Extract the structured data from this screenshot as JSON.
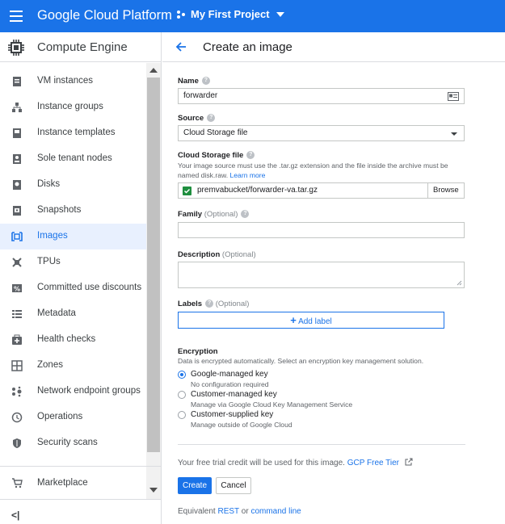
{
  "topbar": {
    "app_title": "Google Cloud Platform",
    "project": "My First Project"
  },
  "sidebar": {
    "title": "Compute Engine",
    "items": [
      {
        "label": "VM instances",
        "icon": "vm-icon"
      },
      {
        "label": "Instance groups",
        "icon": "group-icon"
      },
      {
        "label": "Instance templates",
        "icon": "template-icon"
      },
      {
        "label": "Sole tenant nodes",
        "icon": "node-icon"
      },
      {
        "label": "Disks",
        "icon": "disk-icon"
      },
      {
        "label": "Snapshots",
        "icon": "snapshot-icon"
      },
      {
        "label": "Images",
        "icon": "image-icon",
        "active": true
      },
      {
        "label": "TPUs",
        "icon": "tpu-icon"
      },
      {
        "label": "Committed use discounts",
        "icon": "percent-icon"
      },
      {
        "label": "Metadata",
        "icon": "metadata-icon"
      },
      {
        "label": "Health checks",
        "icon": "health-icon"
      },
      {
        "label": "Zones",
        "icon": "zones-icon"
      },
      {
        "label": "Network endpoint groups",
        "icon": "network-icon"
      },
      {
        "label": "Operations",
        "icon": "clock-icon"
      },
      {
        "label": "Security scans",
        "icon": "shield-icon"
      }
    ],
    "marketplace": "Marketplace",
    "collapse": "<|"
  },
  "page": {
    "title": "Create an image"
  },
  "form": {
    "name_label": "Name",
    "name_value": "forwarder",
    "source_label": "Source",
    "source_value": "Cloud Storage file",
    "csf_label": "Cloud Storage file",
    "csf_help": "Your image source must use the .tar.gz extension and the file inside the archive must be named disk.raw.",
    "learn_more": "Learn more",
    "csf_value": "premvabucket/forwarder-va.tar.gz",
    "browse": "Browse",
    "family_label": "Family",
    "optional": "(Optional)",
    "description_label": "Description",
    "labels_label": "Labels",
    "add_label": "Add label",
    "encryption_label": "Encryption",
    "encryption_help": "Data is encrypted automatically. Select an encryption key management solution.",
    "enc_options": [
      {
        "title": "Google-managed key",
        "sub": "No configuration required",
        "selected": true
      },
      {
        "title": "Customer-managed key",
        "sub": "Manage via Google Cloud Key Management Service",
        "selected": false
      },
      {
        "title": "Customer-supplied key",
        "sub": "Manage outside of Google Cloud",
        "selected": false
      }
    ],
    "trial_text": "Your free trial credit will be used for this image.",
    "free_tier": "GCP Free Tier",
    "create": "Create",
    "cancel": "Cancel",
    "equivalent": "Equivalent",
    "rest": "REST",
    "or": "or",
    "command_line": "command line"
  },
  "colors": {
    "accent": "#1a73e8",
    "active_bg": "#e8f0fe",
    "checkbox": "#1e8e3e"
  }
}
